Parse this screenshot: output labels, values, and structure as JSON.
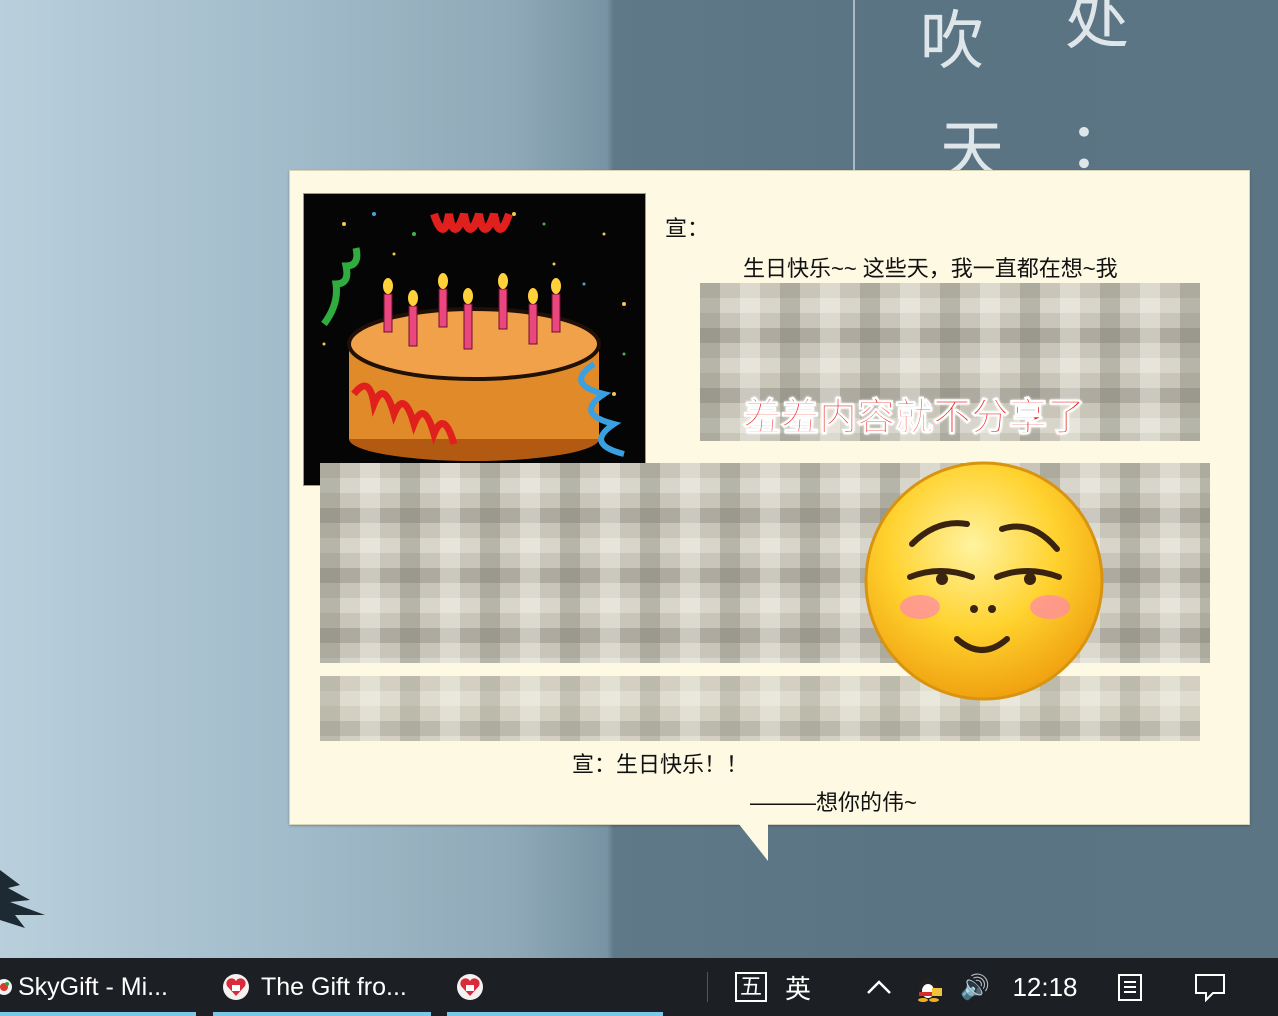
{
  "background": {
    "calligraphy": [
      "吹",
      "处",
      "天",
      "："
    ]
  },
  "popup": {
    "greeting": "宣：",
    "first_line": "生日快乐~~    这些天，我一直都在想~我",
    "censor_label": "羞羞内容就不分享了",
    "closing": "宣：生日快乐！！",
    "signature": "———想你的伟~"
  },
  "taskbar": {
    "items": [
      {
        "label": "SkyGift - Mi...",
        "icon": "skygift-app-icon"
      },
      {
        "label": "The Gift fro...",
        "icon": "heart-gift-icon"
      },
      {
        "label": "",
        "icon": "heart-gift-icon"
      }
    ],
    "ime_mode": "五",
    "ime_lang": "英",
    "clock": "12:18",
    "volume_icon": "🔊",
    "tray_up_arrow": "^"
  },
  "colors": {
    "accent": "#7cc6e8",
    "censor_red": "#e8231d",
    "popup_bg": "#fdf9e3"
  }
}
